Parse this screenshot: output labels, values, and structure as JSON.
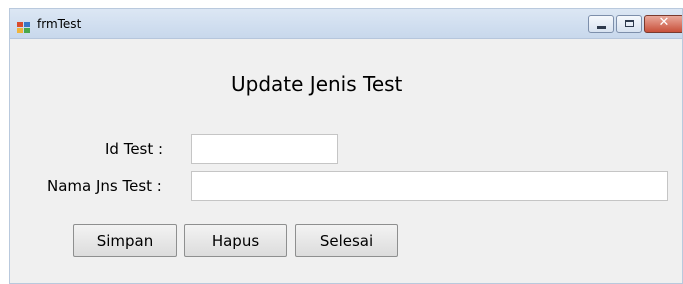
{
  "window": {
    "title": "frmTest",
    "icon": "winforms-app-icon",
    "controls": {
      "minimize": "minimize-icon",
      "maximize": "maximize-icon",
      "close": "close-icon",
      "close_glyph": "✕"
    }
  },
  "form": {
    "heading": "Update Jenis Test",
    "fields": {
      "id_test": {
        "label": "Id Test :",
        "value": ""
      },
      "nama_jns_test": {
        "label": "Nama Jns Test :",
        "value": ""
      }
    },
    "buttons": {
      "simpan": "Simpan",
      "hapus": "Hapus",
      "selesai": "Selesai"
    }
  },
  "colors": {
    "title_bar": "#dce7f4",
    "form_background": "#f0f0f0",
    "close_button": "#c8503a"
  }
}
